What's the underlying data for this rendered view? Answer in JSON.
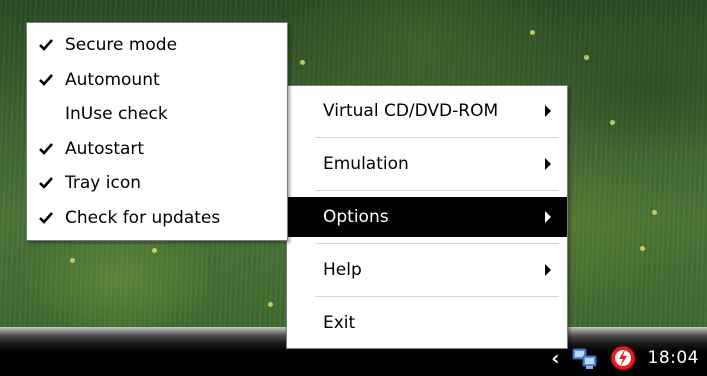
{
  "options_submenu": {
    "items": [
      {
        "label": "Secure mode",
        "checked": true
      },
      {
        "label": "Automount",
        "checked": true
      },
      {
        "label": "InUse check",
        "checked": false
      },
      {
        "label": "Autostart",
        "checked": true
      },
      {
        "label": "Tray icon",
        "checked": true
      },
      {
        "label": "Check for updates",
        "checked": true
      }
    ]
  },
  "tray_menu": {
    "virtual_drive": "Virtual CD/DVD-ROM",
    "emulation": "Emulation",
    "options": "Options",
    "help": "Help",
    "exit": "Exit",
    "active_item": "Options"
  },
  "taskbar": {
    "clock": "18:04",
    "tray_icons": [
      "show-hidden-icons-chevron",
      "network-icon",
      "daemon-tools-icon"
    ]
  },
  "colors": {
    "menu_highlight": "#000000",
    "menu_background": "#ffffff",
    "taskbar": "#000000"
  }
}
